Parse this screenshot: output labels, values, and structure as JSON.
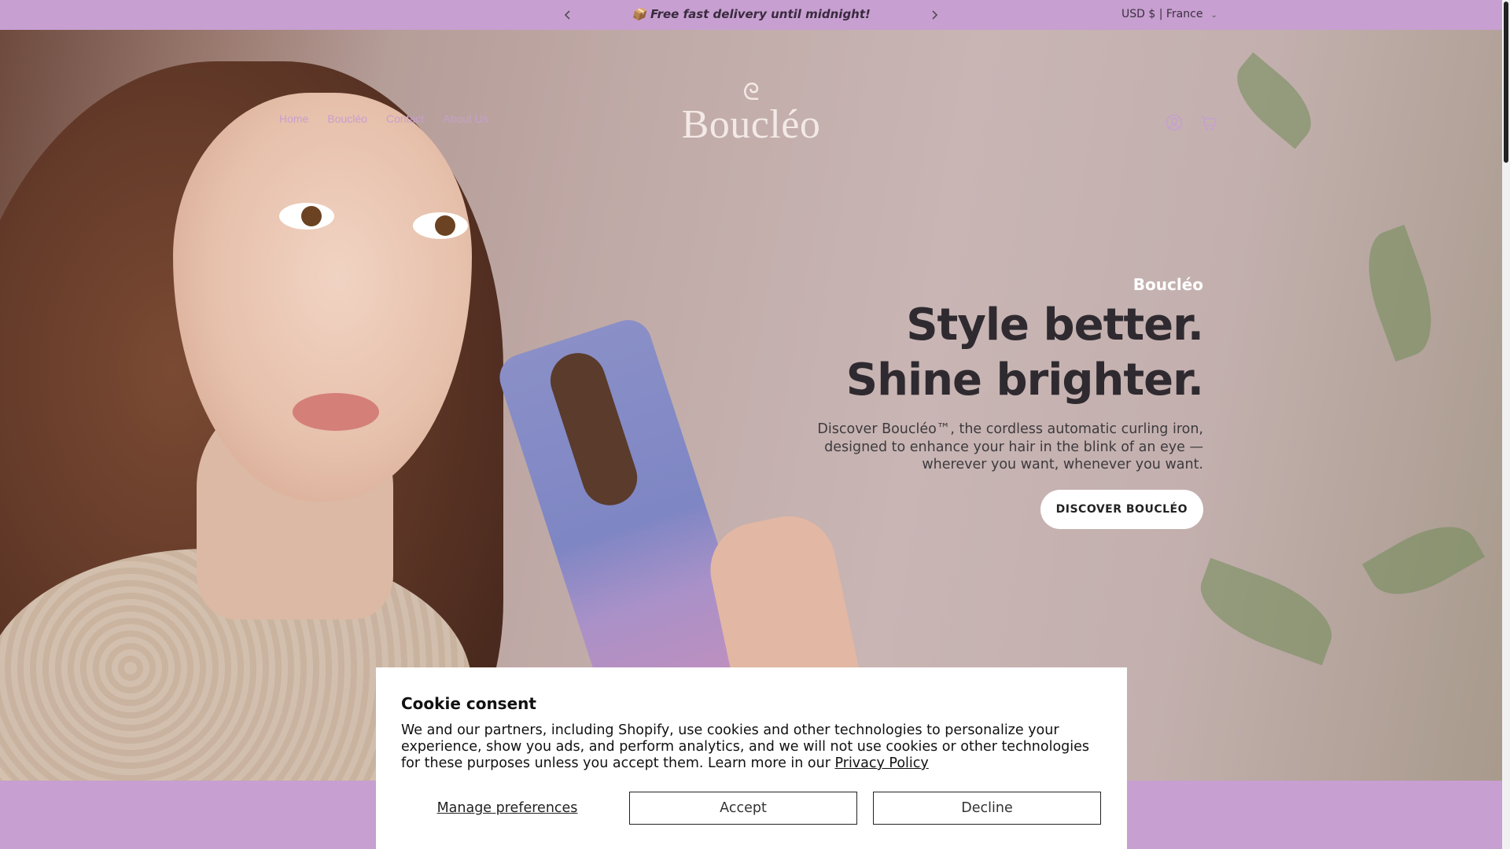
{
  "announcement": {
    "message": "📦 Free fast delivery until midnight!",
    "prev_icon": "chevron-left-icon",
    "next_icon": "chevron-right-icon",
    "currency": "USD $ | France"
  },
  "header": {
    "nav": [
      {
        "label": "Home"
      },
      {
        "label": "Boucléo"
      },
      {
        "label": "Contact"
      },
      {
        "label": "About Us"
      }
    ],
    "logo": {
      "swirl": "ᘓ",
      "text": "Boucléo"
    },
    "icons": [
      "account-icon",
      "cart-icon"
    ]
  },
  "hero": {
    "brand": "Boucléo",
    "headline_1": "Style better.",
    "headline_2": "Shine brighter.",
    "description": "Discover Boucléo™, the cordless automatic curling iron, designed to enhance your hair in the blink of an eye — wherever you want, whenever you want.",
    "cta": "DISCOVER BOUCLÉO"
  },
  "cookie": {
    "title": "Cookie consent",
    "body": "We and our partners, including Shopify, use cookies and other technologies to personalize your experience, show you ads, and perform analytics, and we will not use cookies or other technologies for these purposes unless you accept them. Learn more in our ",
    "link": "Privacy Policy",
    "manage": "Manage preferences",
    "accept": "Accept",
    "decline": "Decline"
  },
  "colors": {
    "accent": "#c79fd0",
    "headline": "#2f2a30"
  }
}
